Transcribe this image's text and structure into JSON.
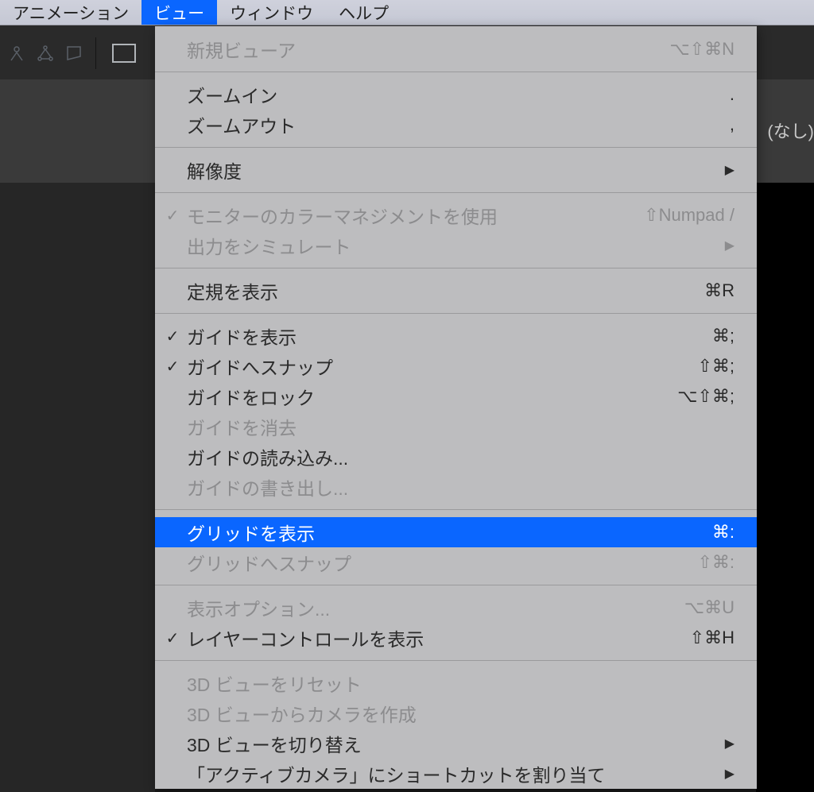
{
  "menubar": {
    "items": [
      {
        "label": "アニメーション",
        "active": false
      },
      {
        "label": "ビュー",
        "active": true
      },
      {
        "label": "ウィンドウ",
        "active": false
      },
      {
        "label": "ヘルプ",
        "active": false
      }
    ]
  },
  "right_label": "(なし)",
  "menu": {
    "groups": [
      [
        {
          "label": "新規ビューア",
          "shortcut": "⌥⇧⌘N",
          "disabled": true,
          "checked": false,
          "submenu": false
        }
      ],
      [
        {
          "label": "ズームイン",
          "shortcut": ".",
          "disabled": false,
          "checked": false,
          "submenu": false
        },
        {
          "label": "ズームアウト",
          "shortcut": ",",
          "disabled": false,
          "checked": false,
          "submenu": false
        }
      ],
      [
        {
          "label": "解像度",
          "shortcut": "",
          "disabled": false,
          "checked": false,
          "submenu": true
        }
      ],
      [
        {
          "label": "モニターのカラーマネジメントを使用",
          "shortcut": "⇧Numpad /",
          "disabled": true,
          "checked": true,
          "submenu": false
        },
        {
          "label": "出力をシミュレート",
          "shortcut": "",
          "disabled": true,
          "checked": false,
          "submenu": true
        }
      ],
      [
        {
          "label": "定規を表示",
          "shortcut": "⌘R",
          "disabled": false,
          "checked": false,
          "submenu": false
        }
      ],
      [
        {
          "label": "ガイドを表示",
          "shortcut": "⌘;",
          "disabled": false,
          "checked": true,
          "submenu": false
        },
        {
          "label": "ガイドへスナップ",
          "shortcut": "⇧⌘;",
          "disabled": false,
          "checked": true,
          "submenu": false
        },
        {
          "label": "ガイドをロック",
          "shortcut": "⌥⇧⌘;",
          "disabled": false,
          "checked": false,
          "submenu": false
        },
        {
          "label": "ガイドを消去",
          "shortcut": "",
          "disabled": true,
          "checked": false,
          "submenu": false
        },
        {
          "label": "ガイドの読み込み...",
          "shortcut": "",
          "disabled": false,
          "checked": false,
          "submenu": false
        },
        {
          "label": "ガイドの書き出し...",
          "shortcut": "",
          "disabled": true,
          "checked": false,
          "submenu": false
        }
      ],
      [
        {
          "label": "グリッドを表示",
          "shortcut": "⌘:",
          "disabled": false,
          "checked": false,
          "submenu": false,
          "highlighted": true
        },
        {
          "label": "グリッドへスナップ",
          "shortcut": "⇧⌘:",
          "disabled": true,
          "checked": false,
          "submenu": false
        }
      ],
      [
        {
          "label": "表示オプション...",
          "shortcut": "⌥⌘U",
          "disabled": true,
          "checked": false,
          "submenu": false
        },
        {
          "label": "レイヤーコントロールを表示",
          "shortcut": "⇧⌘H",
          "disabled": false,
          "checked": true,
          "submenu": false
        }
      ],
      [
        {
          "label": "3D ビューをリセット",
          "shortcut": "",
          "disabled": true,
          "checked": false,
          "submenu": false
        },
        {
          "label": "3D ビューからカメラを作成",
          "shortcut": "",
          "disabled": true,
          "checked": false,
          "submenu": false
        },
        {
          "label": "3D ビューを切り替え",
          "shortcut": "",
          "disabled": false,
          "checked": false,
          "submenu": true
        },
        {
          "label": "「アクティブカメラ」にショートカットを割り当て",
          "shortcut": "",
          "disabled": false,
          "checked": false,
          "submenu": true
        }
      ]
    ]
  }
}
